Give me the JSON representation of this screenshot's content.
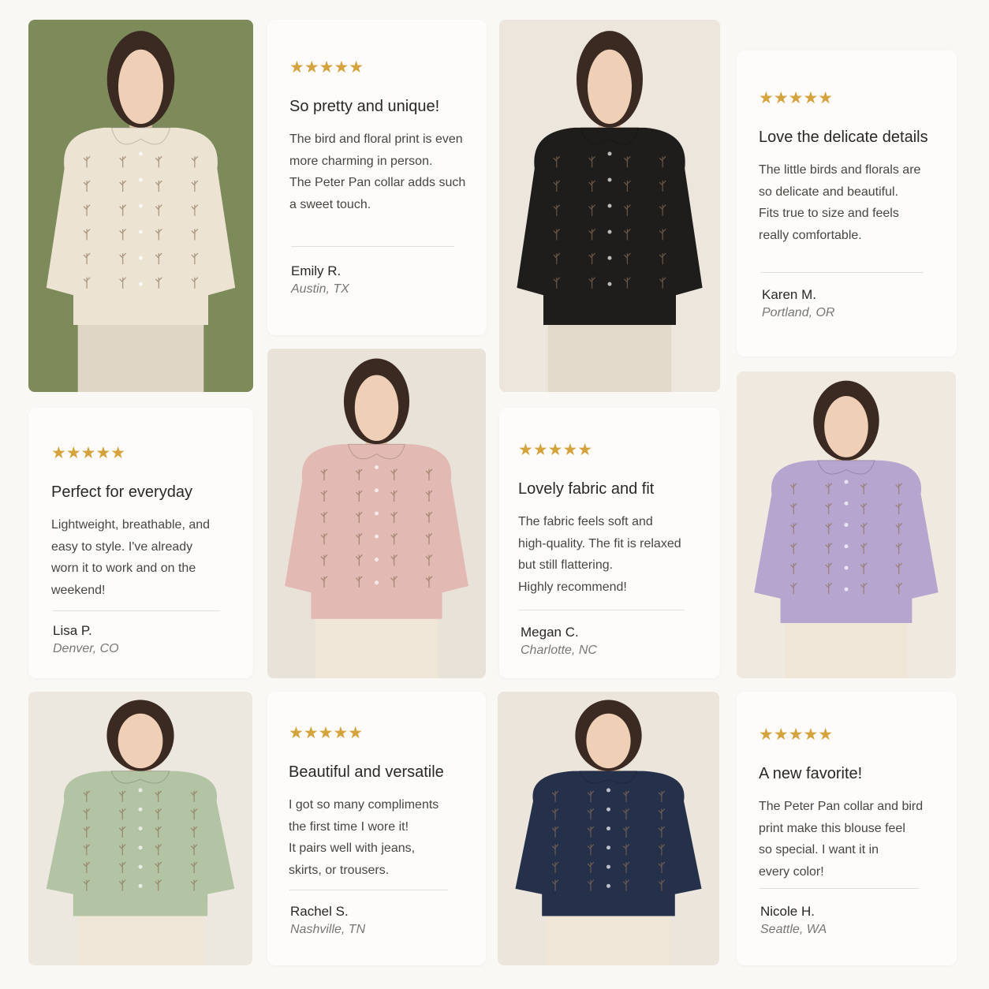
{
  "reviews": [
    {
      "stars": "★★★★★",
      "title": "So pretty and unique!",
      "body": "The bird and floral print is even\nmore charming in person.\nThe Peter Pan collar adds such\na sweet touch.",
      "name": "Emily R.",
      "location": "Austin, TX"
    },
    {
      "stars": "★★★★★",
      "title": "Love the delicate details",
      "body": "The little birds and florals are\nso delicate and beautiful.\nFits true to size and feels\nreally comfortable.",
      "name": "Karen M.",
      "location": "Portland, OR"
    },
    {
      "stars": "★★★★★",
      "title": "Perfect for everyday",
      "body": "Lightweight, breathable, and\neasy to style. I've already\nworn it to work and on the\nweekend!",
      "name": "Lisa P.",
      "location": "Denver, CO"
    },
    {
      "stars": "★★★★★",
      "title": "Lovely fabric and fit",
      "body": "The fabric feels soft and\nhigh-quality. The fit is relaxed\nbut still flattering.\nHighly recommend!",
      "name": "Megan C.",
      "location": "Charlotte, NC"
    },
    {
      "stars": "★★★★★",
      "title": "Beautiful and versatile",
      "body": "I got so many compliments\nthe first time I wore it!\nIt pairs well with jeans,\nskirts, or trousers.",
      "name": "Rachel S.",
      "location": "Nashville, TN"
    },
    {
      "stars": "★★★★★",
      "title": "A new favorite!",
      "body": "The Peter Pan collar and bird\nprint make this blouse feel\nso special. I want it in\nevery color!",
      "name": "Nicole H.",
      "location": "Seattle, WA"
    }
  ],
  "photos": [
    {
      "blouse": "#ece3d2",
      "bg": "#7d8a5a",
      "pants": "#e0d6c6",
      "icon": "cream-blouse-photo"
    },
    {
      "blouse": "#1f1d1c",
      "bg": "#ece6dd",
      "pants": "#e3dacb",
      "icon": "black-blouse-photo"
    },
    {
      "blouse": "#e2b9b3",
      "bg": "#e9e2d8",
      "pants": "#efe6d8",
      "icon": "pink-blouse-photo"
    },
    {
      "blouse": "#b6a6cf",
      "bg": "#efe9e0",
      "pants": "#efe6d8",
      "icon": "lavender-blouse-photo"
    },
    {
      "blouse": "#b3c4a4",
      "bg": "#ede8df",
      "pants": "#efe6d8",
      "icon": "sage-blouse-photo"
    },
    {
      "blouse": "#25304a",
      "bg": "#ebe5db",
      "pants": "#efe6d8",
      "icon": "navy-blouse-photo"
    }
  ]
}
